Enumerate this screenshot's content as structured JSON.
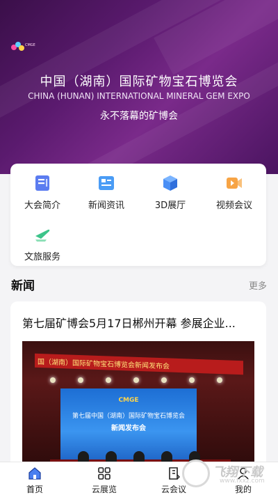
{
  "hero": {
    "title_cn": "中国（湖南）国际矿物宝石博览会",
    "title_en": "CHINA (HUNAN) INTERNATIONAL MINERAL GEM EXPO",
    "slogan": "永不落幕的矿博会",
    "logo_text": "CMGE",
    "colors": {
      "bg_from": "#3a0f49",
      "bg_to": "#7a2a8a"
    }
  },
  "menu": {
    "items": [
      {
        "label": "大会简介",
        "icon": "document-icon",
        "color": "#5b7cf0"
      },
      {
        "label": "新闻资讯",
        "icon": "news-icon",
        "color": "#4a9cf5"
      },
      {
        "label": "3D展厅",
        "icon": "cube-icon",
        "color": "#4a8ff5"
      },
      {
        "label": "视频会议",
        "icon": "video-icon",
        "color": "#f7a445"
      },
      {
        "label": "文旅服务",
        "icon": "plane-icon",
        "color": "#3cc48a"
      }
    ]
  },
  "news": {
    "heading": "新闻",
    "more": "更多",
    "headline": "第七届矿博会5月17日郴州开幕 参展企业...",
    "photo": {
      "banner": "国（湖南）国际矿物宝石博览会新闻发布会",
      "screen_brand": "CMGE",
      "screen_line1": "第七届中国（湖南）国际矿物宝石博览会",
      "screen_line2": "新闻发布会"
    }
  },
  "watermark": {
    "text": "飞翔下载",
    "url": "www.fxxz.com"
  },
  "tabbar": {
    "tabs": [
      {
        "label": "首页",
        "icon": "home-icon",
        "active": true
      },
      {
        "label": "云展览",
        "icon": "grid-icon",
        "active": false
      },
      {
        "label": "云会议",
        "icon": "notebook-icon",
        "active": false
      },
      {
        "label": "我的",
        "icon": "user-icon",
        "active": false
      }
    ]
  }
}
